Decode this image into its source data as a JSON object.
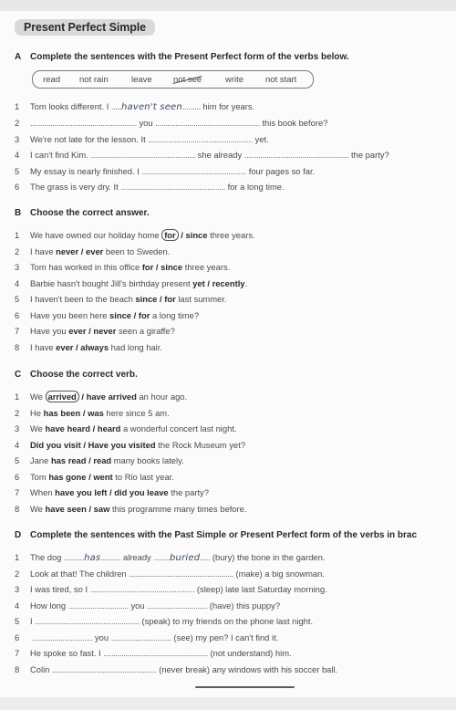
{
  "title": "Present Perfect Simple",
  "sections": {
    "A": {
      "letter": "A",
      "heading": "Complete the sentences with the Present Perfect form of the verbs below.",
      "words": [
        "read",
        "not rain",
        "leave",
        "not see",
        "write",
        "not start"
      ],
      "crossed_word": "not see",
      "items": [
        {
          "num": "1",
          "parts": [
            "Tom looks different. I ",
            "haven't seen",
            " him for years."
          ]
        },
        {
          "num": "2",
          "parts": [
            "",
            " you ",
            " this book before?"
          ]
        },
        {
          "num": "3",
          "parts": [
            "We're not late for the lesson. It ",
            " yet."
          ]
        },
        {
          "num": "4",
          "parts": [
            "I can't find Kim. ",
            " she already ",
            " the party?"
          ]
        },
        {
          "num": "5",
          "parts": [
            "My essay is nearly finished. I ",
            " four pages so far."
          ]
        },
        {
          "num": "6",
          "parts": [
            "The grass is very dry. It ",
            " for a long time."
          ]
        }
      ]
    },
    "B": {
      "letter": "B",
      "heading": "Choose the correct answer.",
      "items": [
        {
          "num": "1",
          "pre": "We have owned our holiday home ",
          "opt1": "for",
          "sep": " / ",
          "opt2": "since",
          "post": " three years.",
          "circled": "for"
        },
        {
          "num": "2",
          "pre": "I have ",
          "opt1": "never",
          "sep": " / ",
          "opt2": "ever",
          "post": " been to Sweden."
        },
        {
          "num": "3",
          "pre": "Tom has worked in this office ",
          "opt1": "for",
          "sep": " / ",
          "opt2": "since",
          "post": " three years."
        },
        {
          "num": "4",
          "pre": "Barbie hasn't bought Jill's birthday present ",
          "opt1": "yet",
          "sep": " / ",
          "opt2": "recently",
          "post": "."
        },
        {
          "num": "5",
          "pre": "I haven't been to the beach ",
          "opt1": "since",
          "sep": " / ",
          "opt2": "for",
          "post": " last summer."
        },
        {
          "num": "6",
          "pre": "Have you been here ",
          "opt1": "since",
          "sep": " / ",
          "opt2": "for",
          "post": " a long time?"
        },
        {
          "num": "7",
          "pre": "Have you ",
          "opt1": "ever",
          "sep": " / ",
          "opt2": "never",
          "post": " seen a giraffe?"
        },
        {
          "num": "8",
          "pre": "I have ",
          "opt1": "ever",
          "sep": " / ",
          "opt2": "always",
          "post": " had long hair."
        }
      ]
    },
    "C": {
      "letter": "C",
      "heading": "Choose the correct verb.",
      "items": [
        {
          "num": "1",
          "pre": "We ",
          "opt1": "arrived",
          "sep": " / ",
          "opt2": "have arrived",
          "post": " an hour ago.",
          "circled": "arrived"
        },
        {
          "num": "2",
          "pre": "He ",
          "opt1": "has been",
          "sep": " / ",
          "opt2": "was",
          "post": " here since 5 am."
        },
        {
          "num": "3",
          "pre": "We ",
          "opt1": "have heard",
          "sep": " / ",
          "opt2": "heard",
          "post": " a wonderful concert last night."
        },
        {
          "num": "4",
          "pre": "",
          "opt1": "Did you visit",
          "sep": " / ",
          "opt2": "Have you visited",
          "post": " the Rock Museum yet?"
        },
        {
          "num": "5",
          "pre": "Jane ",
          "opt1": "has read",
          "sep": " / ",
          "opt2": "read",
          "post": " many books lately."
        },
        {
          "num": "6",
          "pre": "Tom ",
          "opt1": "has gone",
          "sep": " / ",
          "opt2": "went",
          "post": " to Rio last year."
        },
        {
          "num": "7",
          "pre": "When ",
          "opt1": "have you left",
          "sep": " / ",
          "opt2": "did you leave",
          "post": " the party?"
        },
        {
          "num": "8",
          "pre": "We ",
          "opt1": "have seen",
          "sep": " / ",
          "opt2": "saw",
          "post": " this programme many times before."
        }
      ]
    },
    "D": {
      "letter": "D",
      "heading": "Complete the sentences with the Past Simple or Present Perfect form of the verbs in brac",
      "items": [
        {
          "num": "1",
          "parts": [
            "The dog ",
            "has",
            " already ",
            "buried",
            " (bury) the bone in the garden."
          ]
        },
        {
          "num": "2",
          "parts": [
            "Look at that! The children ",
            " (make) a big snowman."
          ]
        },
        {
          "num": "3",
          "parts": [
            "I was tired, so I ",
            " (sleep) late last Saturday morning."
          ]
        },
        {
          "num": "4",
          "parts": [
            "How long ",
            " you ",
            " (have) this puppy?"
          ]
        },
        {
          "num": "5",
          "parts": [
            "I ",
            " (speak) to my friends on the phone last night."
          ]
        },
        {
          "num": "6",
          "parts": [
            "",
            " you ",
            " (see) my pen? I can't find it."
          ]
        },
        {
          "num": "7",
          "parts": [
            "He spoke so fast. I ",
            " (not understand) him."
          ]
        },
        {
          "num": "8",
          "parts": [
            "Colin ",
            " (never break) any windows with his soccer ball."
          ]
        }
      ]
    }
  }
}
